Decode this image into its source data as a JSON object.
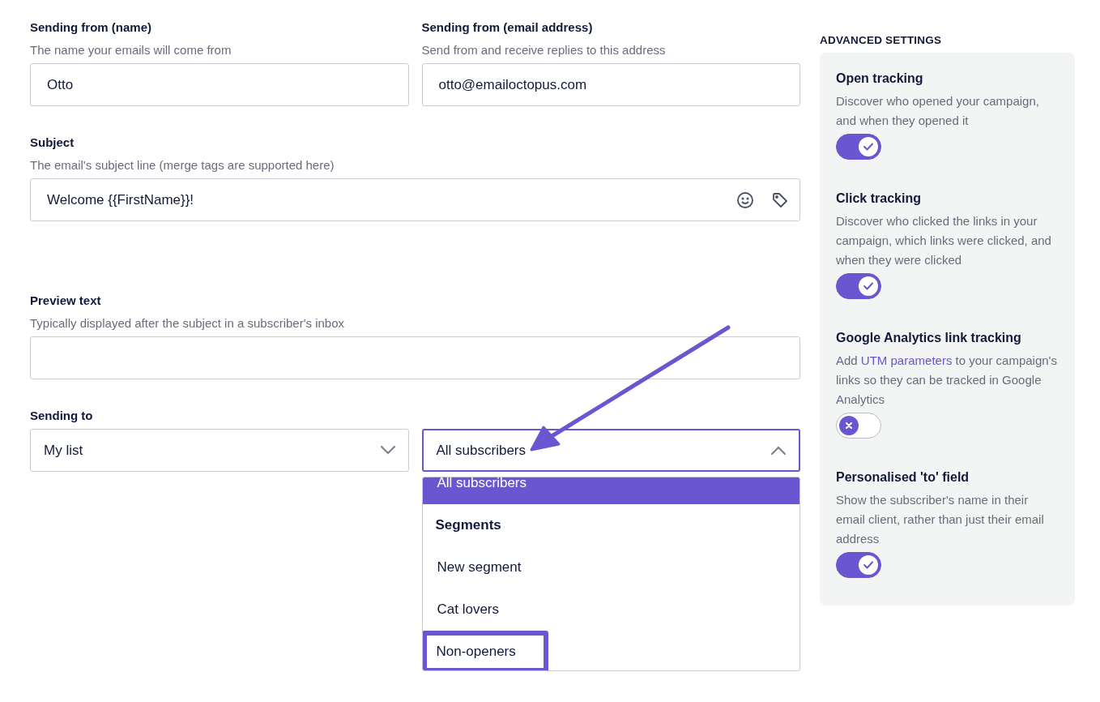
{
  "sender_name": {
    "label": "Sending from (name)",
    "hint": "The name your emails will come from",
    "value": "Otto"
  },
  "sender_email": {
    "label": "Sending from (email address)",
    "hint": "Send from and receive replies to this address",
    "value": "otto@emailoctopus.com"
  },
  "subject": {
    "label": "Subject",
    "hint": "The email's subject line (merge tags are supported here)",
    "value": "Welcome {{FirstName}}!"
  },
  "preview_text": {
    "label": "Preview text",
    "hint": "Typically displayed after the subject in a subscriber's inbox"
  },
  "sending_to": {
    "label": "Sending to",
    "list_select": {
      "value": "My list",
      "open": false
    },
    "segment_select": {
      "value": "All subscribers",
      "open": true
    },
    "options": [
      {
        "kind": "option",
        "label": "All subscribers",
        "selected": true,
        "highlighted": false
      },
      {
        "kind": "group",
        "label": "Segments"
      },
      {
        "kind": "option",
        "label": "New segment",
        "selected": false,
        "highlighted": false
      },
      {
        "kind": "option",
        "label": "Cat lovers",
        "selected": false,
        "highlighted": false
      },
      {
        "kind": "option",
        "label": "Non-openers",
        "selected": false,
        "highlighted": true
      }
    ]
  },
  "advanced_settings": {
    "title": "ADVANCED SETTINGS",
    "items": [
      {
        "title": "Open tracking",
        "description": [
          {
            "kind": "text",
            "text": "Discover who opened your campaign, and when they opened it"
          }
        ],
        "on": true
      },
      {
        "title": "Click tracking",
        "description": [
          {
            "kind": "text",
            "text": "Discover who clicked the links in your campaign, which links were clicked, and when they were clicked"
          }
        ],
        "on": true
      },
      {
        "title": "Google Analytics link tracking",
        "description": [
          {
            "kind": "text",
            "text": "Add "
          },
          {
            "kind": "link",
            "text": "UTM parameters"
          },
          {
            "kind": "text",
            "text": " to your campaign's links so they can be tracked in Google Analytics"
          }
        ],
        "on": false
      },
      {
        "title": "Personalised 'to' field",
        "description": [
          {
            "kind": "text",
            "text": "Show the subscriber's name in their email client, rather than just their email address"
          }
        ],
        "on": true
      }
    ]
  }
}
